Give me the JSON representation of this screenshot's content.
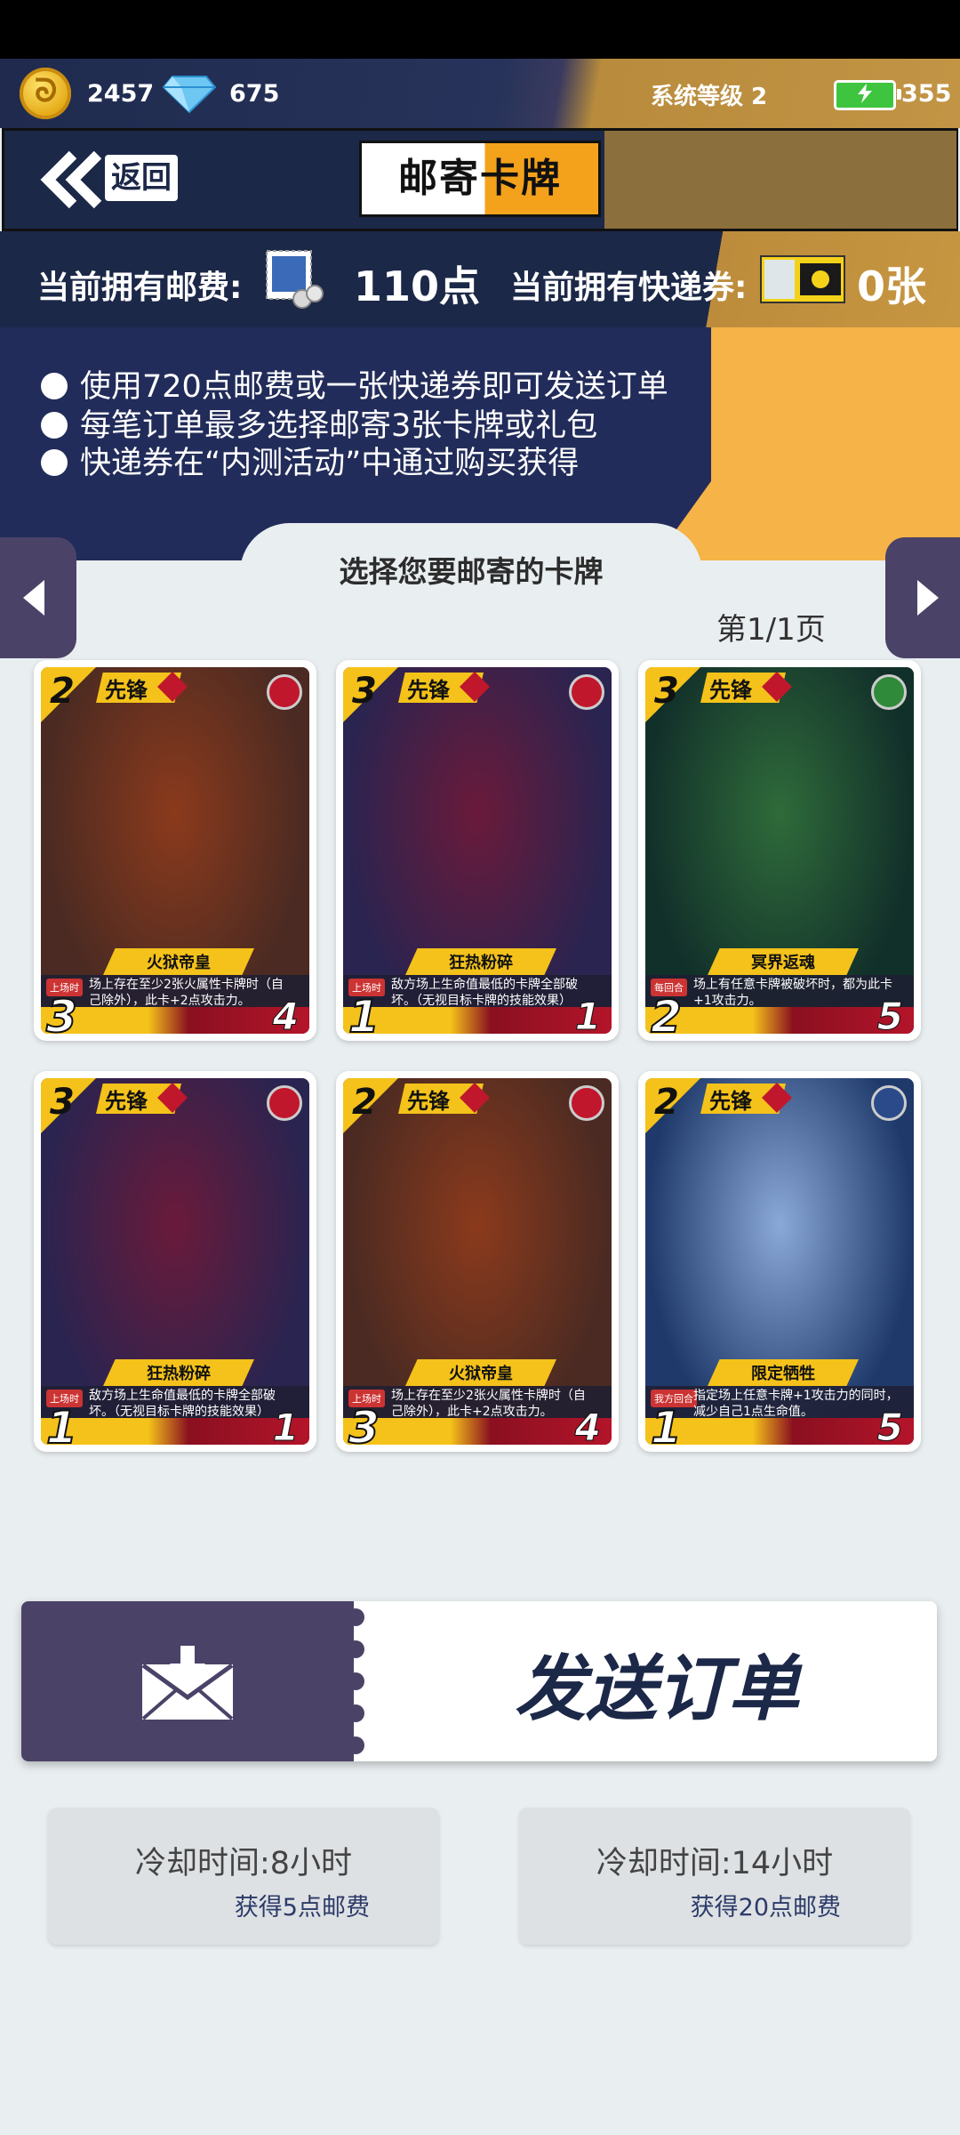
{
  "top_bar": {
    "coins": "2457",
    "gems": "675",
    "system_level": "系统等级 2",
    "energy": "355"
  },
  "header": {
    "back_label": "返回",
    "title": "邮寄卡牌"
  },
  "postage": {
    "postage_label": "当前拥有邮费:",
    "postage_value": "110点",
    "ticket_label": "当前拥有快递券:",
    "ticket_value": "0张"
  },
  "info": {
    "lines": [
      "使用720点邮费或一张快递券即可发送订单",
      "每笔订单最多选择邮寄3张卡牌或礼包",
      "快递券在“内测活动”中通过购买获得"
    ]
  },
  "select": {
    "title": "选择您要邮寄的卡牌",
    "page": "第1/1页"
  },
  "cards": [
    {
      "cost": "2",
      "type": "先锋",
      "name": "火狱帝皇",
      "tag": "上场时",
      "desc": "场上存在至少2张火属性卡牌时（自己除外），此卡+2点攻击力。",
      "attack": "3",
      "hp": "4",
      "art": "#4a2a22",
      "art2": "#8b3a1c",
      "faction": "#c0172d"
    },
    {
      "cost": "3",
      "type": "先锋",
      "name": "狂热粉碎",
      "tag": "上场时",
      "desc": "敌方场上生命值最低的卡牌全部破坏。（无视目标卡牌的技能效果）",
      "attack": "1",
      "hp": "1",
      "art": "#2a2450",
      "art2": "#6a1a3a",
      "faction": "#c0172d"
    },
    {
      "cost": "3",
      "type": "先锋",
      "name": "冥界返魂",
      "tag": "每回合",
      "desc": "场上有任意卡牌被破坏时，都为此卡+1攻击力。",
      "attack": "2",
      "hp": "5",
      "art": "#12302a",
      "art2": "#2f6b3a",
      "faction": "#2f8a3a"
    },
    {
      "cost": "3",
      "type": "先锋",
      "name": "狂热粉碎",
      "tag": "上场时",
      "desc": "敌方场上生命值最低的卡牌全部破坏。（无视目标卡牌的技能效果）",
      "attack": "1",
      "hp": "1",
      "art": "#2a2450",
      "art2": "#6a1a3a",
      "faction": "#c0172d"
    },
    {
      "cost": "2",
      "type": "先锋",
      "name": "火狱帝皇",
      "tag": "上场时",
      "desc": "场上存在至少2张火属性卡牌时（自己除外），此卡+2点攻击力。",
      "attack": "3",
      "hp": "4",
      "art": "#4a2a22",
      "art2": "#8b3a1c",
      "faction": "#c0172d"
    },
    {
      "cost": "2",
      "type": "先锋",
      "name": "限定牺牲",
      "tag": "我方回合",
      "desc": "指定场上任意卡牌+1攻击力的同时，减少自己1点生命值。",
      "attack": "1",
      "hp": "5",
      "art": "#1f3a6a",
      "art2": "#8aa8d8",
      "faction": "#2a4a8a"
    }
  ],
  "send_order": {
    "label": "发送订单"
  },
  "cooldowns": [
    {
      "main": "冷却时间:8小时",
      "sub": "获得5点邮费"
    },
    {
      "main": "冷却时间:14小时",
      "sub": "获得20点邮费"
    }
  ]
}
